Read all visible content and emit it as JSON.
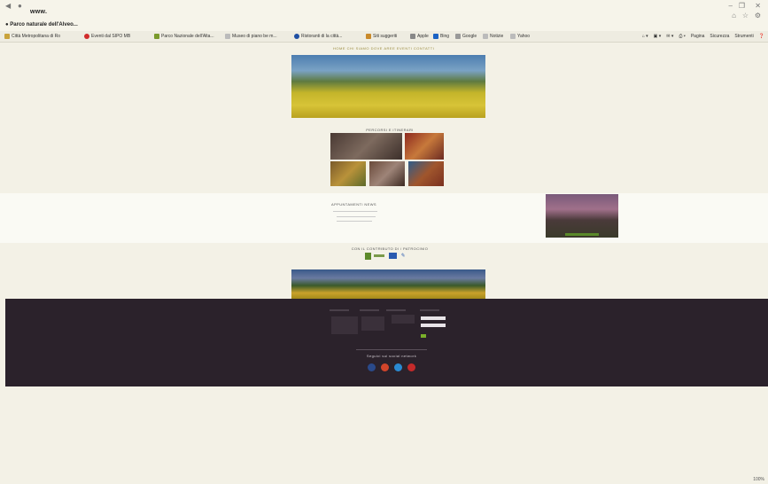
{
  "browser": {
    "address": "www.",
    "tab_title": "Parco naturale dell'Alveo...",
    "bookmarks": [
      "Città Metropolitana di Ro",
      "Eventi dal SIPO MB",
      "Parco Nazionale dell'Alta...",
      "Museo di piano be m...",
      "Ristoranti di la città...",
      "Siti suggeriti",
      "Apple",
      "Bing",
      "Google",
      "Notizie",
      "Yahoo"
    ],
    "tools": [
      "Pagina",
      "Sicurezza",
      "Strumenti"
    ],
    "zoom": "100%"
  },
  "site": {
    "nav": "HOME  CHI SIAMO  DOVE  AREE  EVENTI  CONTATTI",
    "section_gallery": "PERCORSI E ITINERARI",
    "section_news": "APPUNTAMENTI NEWS",
    "section_partners": "CON IL CONTRIBUTO DI / PATROCINIO",
    "footer_follow": "Seguici sui social network"
  },
  "colors": {
    "footer_bg": "#2b222b",
    "page_bg": "#f3f1e6"
  }
}
